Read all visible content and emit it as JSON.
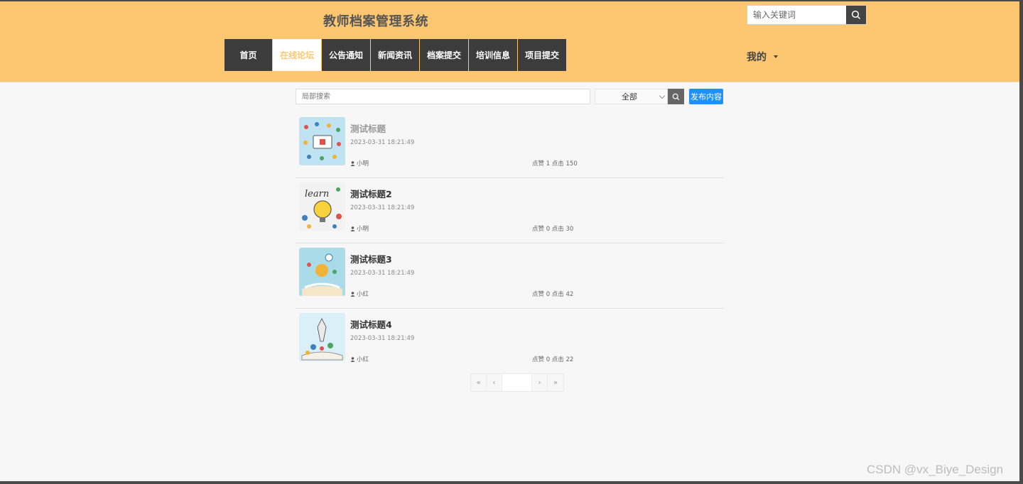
{
  "header": {
    "site_title": "教师档案管理系统",
    "search_placeholder": "输入关键词",
    "mine_label": "我的",
    "nav": [
      "首页",
      "在线论坛",
      "公告通知",
      "新闻资讯",
      "档案提交",
      "培训信息",
      "项目提交"
    ]
  },
  "toolbar": {
    "local_search_placeholder": "局部搜索",
    "select_value": "全部",
    "publish_label": "发布内容"
  },
  "posts": [
    {
      "title": "测试标题",
      "date": "2023-03-31 18:21:49",
      "author": "小明",
      "stats": "点赞 1 点击 150"
    },
    {
      "title": "测试标题2",
      "date": "2023-03-31 18:21:49",
      "author": "小明",
      "stats": "点赞 0 点击 30"
    },
    {
      "title": "测试标题3",
      "date": "2023-03-31 18:21:49",
      "author": "小红",
      "stats": "点赞 0 点击 42"
    },
    {
      "title": "测试标题4",
      "date": "2023-03-31 18:21:49",
      "author": "小红",
      "stats": "点赞 0 点击 22"
    }
  ],
  "pager": [
    "«",
    "‹",
    "",
    "›",
    "»"
  ],
  "watermark": "CSDN @vx_Biye_Design",
  "colors": {
    "header_bg": "#fdc772",
    "nav_bg": "#3c3c3c",
    "nav_active_text": "#fdc772",
    "publish_button": "#1e90ff"
  }
}
